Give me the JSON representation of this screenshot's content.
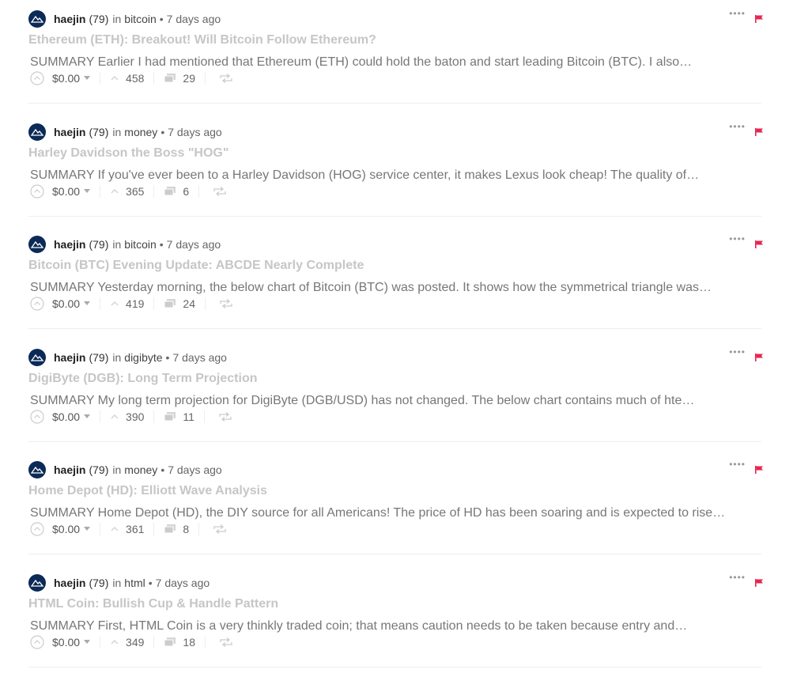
{
  "colors": {
    "avatar_bg": "#0b2a57",
    "flag": "#e8244d",
    "title_text": "#c6c6c6",
    "summary_text": "#777777"
  },
  "icons": {
    "avatar": "mountain-logo",
    "menu": "more-dots-icon",
    "flag": "flag-icon",
    "vote": "upvote-circle-icon",
    "votes": "chevron-up-icon",
    "comments": "comments-icon",
    "resteem": "resteem-icon"
  },
  "posts": [
    {
      "author": "haejin",
      "reputation": "(79)",
      "in_word": "in",
      "category": "bitcoin",
      "separator": "•",
      "time": "7 days ago",
      "title": "Ethereum (ETH): Breakout! Will Bitcoin Follow Ethereum?",
      "summary": "SUMMARY Earlier I had mentioned that Ethereum (ETH) could hold the baton and start leading Bitcoin (BTC). I also…",
      "payout": "$0.00",
      "votes": "458",
      "comments": "29"
    },
    {
      "author": "haejin",
      "reputation": "(79)",
      "in_word": "in",
      "category": "money",
      "separator": "•",
      "time": "7 days ago",
      "title": "Harley Davidson the Boss \"HOG\"",
      "summary": "SUMMARY If you've ever been to a Harley Davidson (HOG) service center, it makes Lexus look cheap! The quality of…",
      "payout": "$0.00",
      "votes": "365",
      "comments": "6"
    },
    {
      "author": "haejin",
      "reputation": "(79)",
      "in_word": "in",
      "category": "bitcoin",
      "separator": "•",
      "time": "7 days ago",
      "title": "Bitcoin (BTC) Evening Update: ABCDE Nearly Complete",
      "summary": "SUMMARY Yesterday morning, the below chart of Bitcoin (BTC) was posted. It shows how the symmetrical triangle was…",
      "payout": "$0.00",
      "votes": "419",
      "comments": "24"
    },
    {
      "author": "haejin",
      "reputation": "(79)",
      "in_word": "in",
      "category": "digibyte",
      "separator": "•",
      "time": "7 days ago",
      "title": "DigiByte (DGB): Long Term Projection",
      "summary": "SUMMARY My long term projection for DigiByte (DGB/USD) has not changed. The below chart contains much of hte…",
      "payout": "$0.00",
      "votes": "390",
      "comments": "11"
    },
    {
      "author": "haejin",
      "reputation": "(79)",
      "in_word": "in",
      "category": "money",
      "separator": "•",
      "time": "7 days ago",
      "title": "Home Depot (HD): Elliott Wave Analysis",
      "summary": "SUMMARY Home Depot (HD), the DIY source for all Americans! The price of HD has been soaring and is expected to rise…",
      "payout": "$0.00",
      "votes": "361",
      "comments": "8"
    },
    {
      "author": "haejin",
      "reputation": "(79)",
      "in_word": "in",
      "category": "html",
      "separator": "•",
      "time": "7 days ago",
      "title": "HTML Coin: Bullish Cup & Handle Pattern",
      "summary": "SUMMARY First, HTML Coin is a very thinkly traded coin; that means caution needs to be taken because entry and…",
      "payout": "$0.00",
      "votes": "349",
      "comments": "18"
    }
  ]
}
